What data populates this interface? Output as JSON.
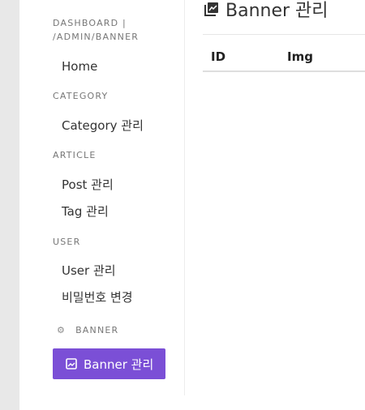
{
  "sidebar": {
    "breadcrumb_line1": "DASHBOARD |",
    "breadcrumb_line2": "/ADMIN/BANNER",
    "home_label": "Home",
    "sections": [
      {
        "label": "CATEGORY",
        "items": [
          "Category 관리"
        ]
      },
      {
        "label": "ARTICLE",
        "items": [
          "Post 관리",
          "Tag 관리"
        ]
      },
      {
        "label": "USER",
        "items": [
          "User 관리",
          "비밀번호 변경"
        ]
      }
    ],
    "banner_section": {
      "label": "BANNER",
      "icon": "gear-icon"
    },
    "active_item": {
      "label": "Banner 관리",
      "icon": "image-icon"
    }
  },
  "main": {
    "title": "Banner 관리",
    "title_icon": "image-icon",
    "table": {
      "columns": [
        "ID",
        "Img"
      ]
    }
  },
  "colors": {
    "accent": "#7b4fd6",
    "outer_bg": "#e8e8e8",
    "panel_bg": "#ffffff"
  }
}
